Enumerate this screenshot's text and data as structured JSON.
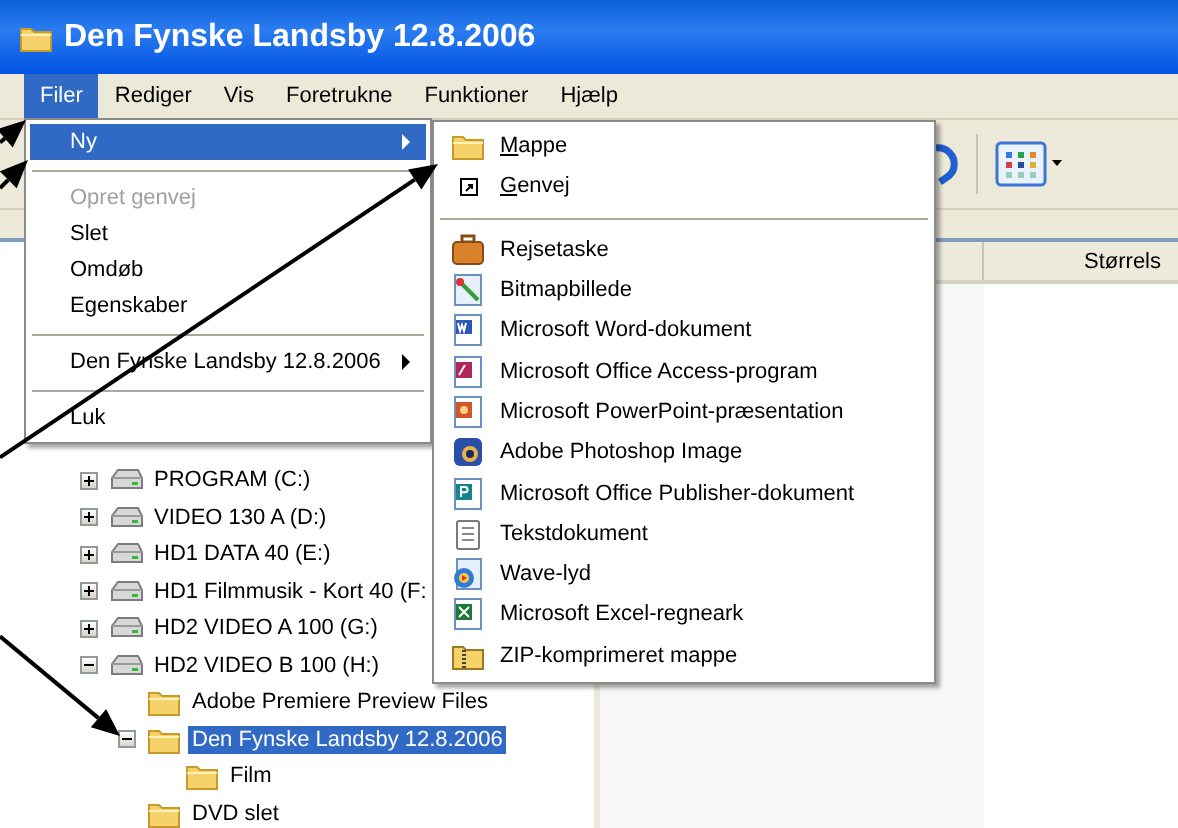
{
  "window": {
    "title": "Den Fynske Landsby 12.8.2006"
  },
  "menubar": [
    {
      "label": "Filer",
      "selected": true
    },
    {
      "label": "Rediger",
      "selected": false
    },
    {
      "label": "Vis",
      "selected": false
    },
    {
      "label": "Foretrukne",
      "selected": false
    },
    {
      "label": "Funktioner",
      "selected": false
    },
    {
      "label": "Hjælp",
      "selected": false
    }
  ],
  "file_menu": [
    {
      "kind": "item",
      "label": "Ny",
      "selected": true,
      "disabled": false,
      "submenu": true
    },
    {
      "kind": "separator"
    },
    {
      "kind": "item",
      "label": "Opret genvej",
      "selected": false,
      "disabled": true,
      "submenu": false
    },
    {
      "kind": "item",
      "label": "Slet",
      "selected": false,
      "disabled": false,
      "submenu": false
    },
    {
      "kind": "item",
      "label": "Omdøb",
      "selected": false,
      "disabled": false,
      "submenu": false
    },
    {
      "kind": "item",
      "label": "Egenskaber",
      "selected": false,
      "disabled": false,
      "submenu": false
    },
    {
      "kind": "separator"
    },
    {
      "kind": "item",
      "label": "Den Fynske Landsby 12.8.2006",
      "selected": false,
      "disabled": false,
      "submenu": true
    },
    {
      "kind": "separator"
    },
    {
      "kind": "item",
      "label": "Luk",
      "selected": false,
      "disabled": false,
      "submenu": false
    }
  ],
  "new_submenu": [
    {
      "kind": "item",
      "label": "Mappe",
      "mnemonic": true
    },
    {
      "kind": "item",
      "label": "Genvej",
      "mnemonic": true
    },
    {
      "kind": "separator"
    },
    {
      "kind": "item",
      "label": "Rejsetaske",
      "mnemonic": false
    },
    {
      "kind": "item",
      "label": "Bitmapbillede",
      "mnemonic": false
    },
    {
      "kind": "item",
      "label": "Microsoft Word-dokument",
      "mnemonic": false
    },
    {
      "kind": "item",
      "label": "Microsoft Office Access-program",
      "mnemonic": false
    },
    {
      "kind": "item",
      "label": "Microsoft PowerPoint-præsentation",
      "mnemonic": false
    },
    {
      "kind": "item",
      "label": "Adobe Photoshop Image",
      "mnemonic": false
    },
    {
      "kind": "item",
      "label": "Microsoft Office Publisher-dokument",
      "mnemonic": false
    },
    {
      "kind": "item",
      "label": "Tekstdokument",
      "mnemonic": false
    },
    {
      "kind": "item",
      "label": "Wave-lyd",
      "mnemonic": false
    },
    {
      "kind": "item",
      "label": "Microsoft Excel-regneark",
      "mnemonic": false
    },
    {
      "kind": "item",
      "label": "ZIP-komprimeret mappe",
      "mnemonic": false
    }
  ],
  "columns": [
    "Størrels"
  ],
  "tree": [
    {
      "label": "PROGRAM (C:)",
      "kind": "drive",
      "expandable": true,
      "expanded": false,
      "selected": false
    },
    {
      "label": "VIDEO 130 A (D:)",
      "kind": "drive",
      "expandable": true,
      "expanded": false,
      "selected": false
    },
    {
      "label": "HD1 DATA 40 (E:)",
      "kind": "drive",
      "expandable": true,
      "expanded": false,
      "selected": false
    },
    {
      "label": "HD1 Filmmusik - Kort 40 (F:",
      "kind": "drive",
      "expandable": true,
      "expanded": false,
      "selected": false
    },
    {
      "label": "HD2 VIDEO A 100 (G:)",
      "kind": "drive",
      "expandable": true,
      "expanded": false,
      "selected": false
    },
    {
      "label": "HD2 VIDEO B 100 (H:)",
      "kind": "drive",
      "expandable": true,
      "expanded": true,
      "selected": false,
      "children": [
        {
          "label": "Adobe Premiere Preview Files",
          "kind": "folder",
          "expandable": false,
          "selected": false
        },
        {
          "label": "Den Fynske Landsby 12.8.2006",
          "kind": "folder",
          "expandable": true,
          "expanded": true,
          "selected": true,
          "children": [
            {
              "label": "Film",
              "kind": "folder",
              "expandable": false,
              "selected": false
            }
          ]
        },
        {
          "label": "DVD slet",
          "kind": "folder",
          "expandable": false,
          "selected": false
        }
      ]
    }
  ]
}
